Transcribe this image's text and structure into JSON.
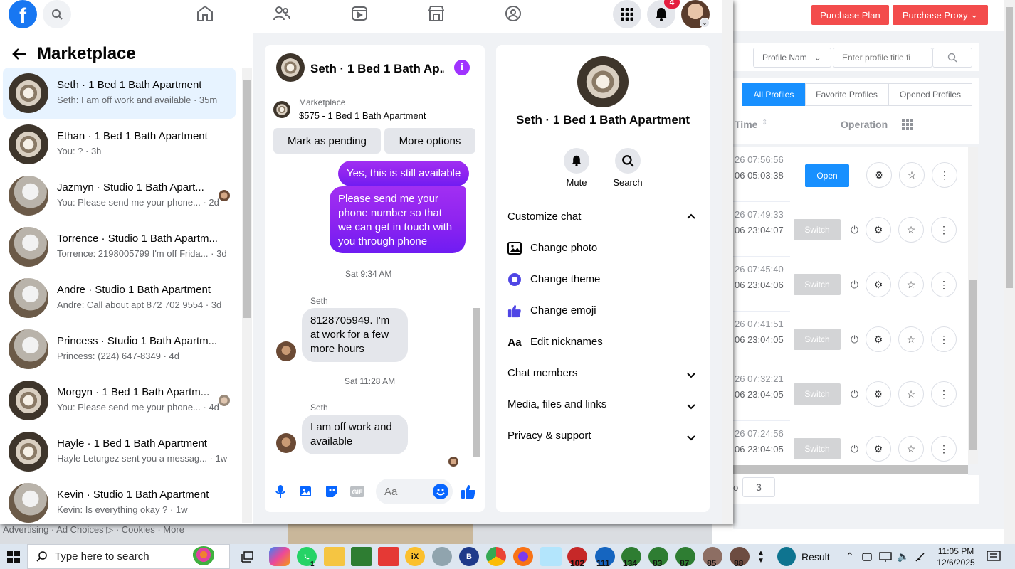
{
  "facebook": {
    "notif_count": "4",
    "marketplace_title": "Marketplace",
    "conversations": [
      {
        "name": "Seth · 1 Bed 1 Bath Apartment",
        "snippet": "Seth: I am off work and available · 35m"
      },
      {
        "name": "Ethan · 1 Bed 1 Bath Apartment",
        "snippet": "You: ? · 3h"
      },
      {
        "name": "Jazmyn · Studio 1 Bath Apart...",
        "snippet": "You: Please send me your phone... · 2d"
      },
      {
        "name": "Torrence · Studio 1 Bath Apartm...",
        "snippet": "Torrence: 2198005799 I'm off Frida... · 3d"
      },
      {
        "name": "Andre · Studio 1 Bath Apartment",
        "snippet": "Andre: Call about apt 872 702 9554 · 3d"
      },
      {
        "name": "Princess · Studio 1 Bath Apartm...",
        "snippet": "Princess: (224) 647-8349 · 4d"
      },
      {
        "name": "Morgyn · 1 Bed 1 Bath Apartm...",
        "snippet": "You: Please send me your phone... · 4d"
      },
      {
        "name": "Hayle · 1 Bed 1 Bath Apartment",
        "snippet": "Hayle Leturgez sent you a messag... · 1w"
      },
      {
        "name": "Kevin · Studio 1 Bath Apartment",
        "snippet": "Kevin: Is everything okay ? · 1w"
      }
    ],
    "chat": {
      "title": "Seth · 1 Bed 1 Bath Ap...",
      "mp_label": "Marketplace",
      "mp_item": "$575 - 1 Bed 1 Bath Apartment",
      "mark_pending": "Mark as pending",
      "more_options": "More options",
      "msg1": "Yes, this is still available",
      "msg2": "Please send me your phone  number so that we can get in touch with you through phone",
      "ts1": "Sat 9:34 AM",
      "sender1": "Seth",
      "msg3": "8128705949. I'm at work for a few more hours",
      "ts2": "Sat 11:28 AM",
      "sender2": "Seth",
      "msg4": "I am off work and available",
      "input_placeholder": "Aa"
    },
    "info": {
      "name": "Seth · 1 Bed 1 Bath Apartment",
      "mute": "Mute",
      "search": "Search",
      "customize": "Customize chat",
      "change_photo": "Change photo",
      "change_theme": "Change theme",
      "change_emoji": "Change emoji",
      "edit_nicknames": "Edit nicknames",
      "chat_members": "Chat members",
      "media": "Media, files and links",
      "privacy": "Privacy & support"
    },
    "below": "Advertising · Ad Choices ▷ · Cookies · More"
  },
  "proxy_app": {
    "purchase_plan": "Purchase Plan",
    "purchase_proxy": "Purchase Proxy",
    "profile_select": "Profile Nam",
    "title_placeholder": "Enter profile title fi",
    "tabs": [
      "All Profiles",
      "Favorite Profiles",
      "Opened Profiles"
    ],
    "col_time": "Time",
    "col_operation": "Operation",
    "rows": [
      {
        "t1": "26 07:56:56",
        "t2": "06 05:03:38",
        "action": "Open"
      },
      {
        "t1": "26 07:49:33",
        "t2": "06 23:04:07",
        "action": "Switch"
      },
      {
        "t1": "26 07:45:40",
        "t2": "06 23:04:06",
        "action": "Switch"
      },
      {
        "t1": "26 07:41:51",
        "t2": "06 23:04:05",
        "action": "Switch"
      },
      {
        "t1": "26 07:32:21",
        "t2": "06 23:04:05",
        "action": "Switch"
      },
      {
        "t1": "26 07:24:56",
        "t2": "06 23:04:05",
        "action": "Switch"
      }
    ],
    "pager_prefix": "o",
    "page_value": "3"
  },
  "taskbar": {
    "search_placeholder": "Type here to search",
    "badges": [
      "1",
      "102",
      "111",
      "134",
      "83",
      "87",
      "85",
      "88"
    ],
    "result": "Result",
    "time": "11:05 PM",
    "date": "12/6/2025"
  }
}
